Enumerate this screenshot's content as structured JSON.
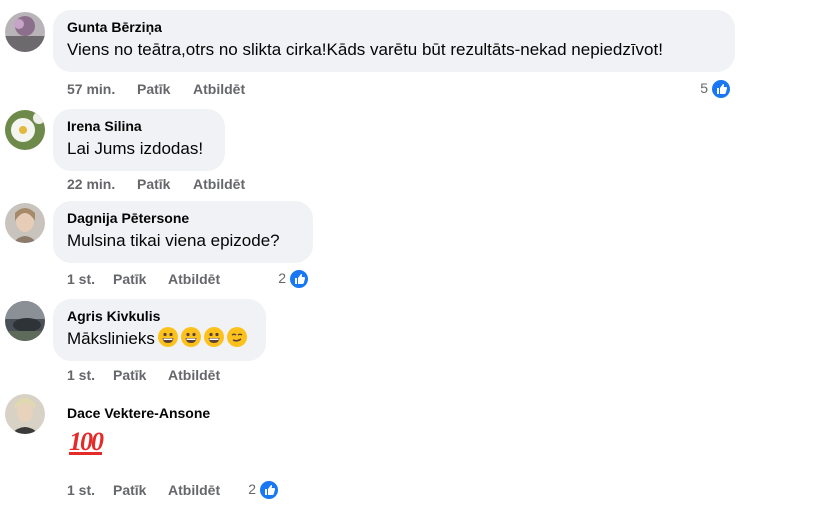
{
  "comments": [
    {
      "author": "Gunta Bērziņa",
      "text": "Viens no teātra,otrs no slikta cirka!Kāds varētu būt rezultāts-nekad nepiedzīvot!",
      "time": "57 min.",
      "like_label": "Patīk",
      "reply_label": "Atbildēt",
      "reactions": "5"
    },
    {
      "author": "Irena Silina",
      "text": "Lai Jums izdodas!",
      "time": "22 min.",
      "like_label": "Patīk",
      "reply_label": "Atbildēt"
    },
    {
      "author": "Dagnija Pētersone",
      "text": "Mulsina tikai viena epizode?",
      "time": "1 st.",
      "like_label": "Patīk",
      "reply_label": "Atbildēt",
      "reactions": "2"
    },
    {
      "author": "Agris Kivkulis",
      "text": "Mākslinieks",
      "emojis": [
        "grinning-face-icon",
        "grinning-face-icon",
        "grinning-face-icon",
        "smirking-face-icon"
      ],
      "time": "1 st.",
      "like_label": "Patīk",
      "reply_label": "Atbildēt"
    },
    {
      "author": "Dace Vektere-Ansone",
      "sticker": "100",
      "time": "1 st.",
      "like_label": "Patīk",
      "reply_label": "Atbildēt",
      "reactions": "2"
    }
  ],
  "colors": {
    "like_blue": "#1877f2",
    "bubble_bg": "#f0f2f5",
    "meta_gray": "#65676b"
  }
}
